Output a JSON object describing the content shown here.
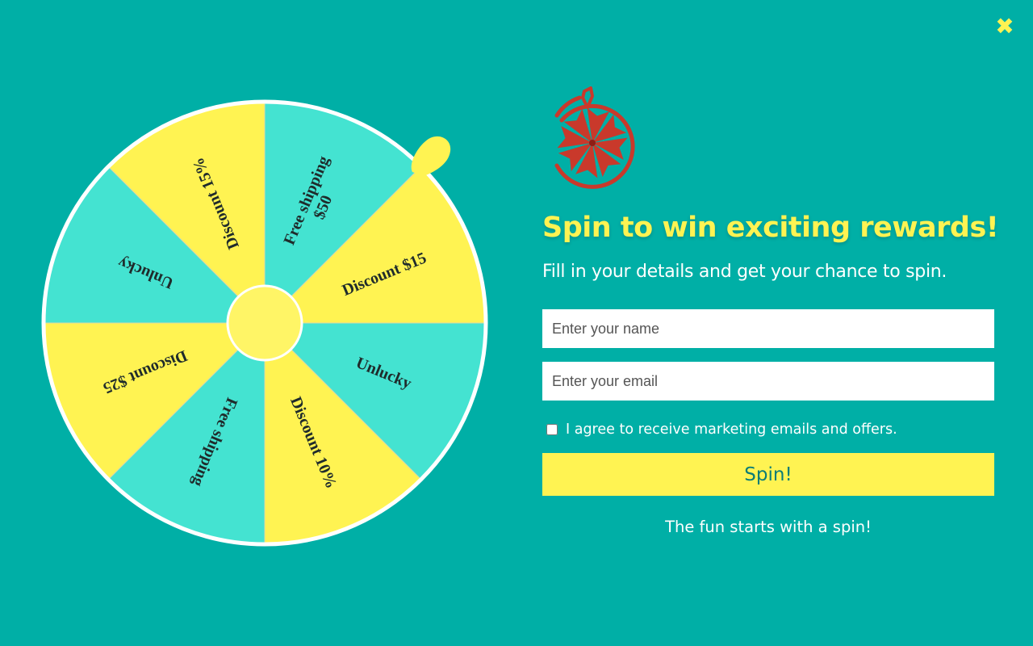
{
  "close": {
    "label": "✖",
    "icon": "close-icon"
  },
  "wheel": {
    "segments": [
      {
        "label": "Free shipping\n$50",
        "color": "#44E3D1"
      },
      {
        "label": "Discount $15",
        "color": "#FFF352"
      },
      {
        "label": "Unlucky",
        "color": "#44E3D1"
      },
      {
        "label": "Discount 10%",
        "color": "#FFF352"
      },
      {
        "label": "Free shipping",
        "color": "#44E3D1"
      },
      {
        "label": "Discount $25",
        "color": "#FFF352"
      },
      {
        "label": "Unlucky",
        "color": "#44E3D1"
      },
      {
        "label": "Discount 15%",
        "color": "#FFF352"
      }
    ],
    "pointer_color": "#FFF352",
    "hub_color": "#FFF566"
  },
  "panel": {
    "logo_icon": "spin-wheel-logo-icon",
    "title": "Spin to win exciting rewards!",
    "subtitle": "Fill in your details and get your chance to spin.",
    "name_placeholder": "Enter your name",
    "email_placeholder": "Enter your email",
    "agree_label": "I agree to receive marketing emails and offers.",
    "agree_checked": false,
    "spin_label": "Spin!",
    "tagline": "The fun starts with a spin!"
  },
  "colors": {
    "background": "#00AFA6",
    "accent_yellow": "#FFF352",
    "accent_turquoise": "#44E3D1",
    "logo_red": "#C9392B"
  }
}
